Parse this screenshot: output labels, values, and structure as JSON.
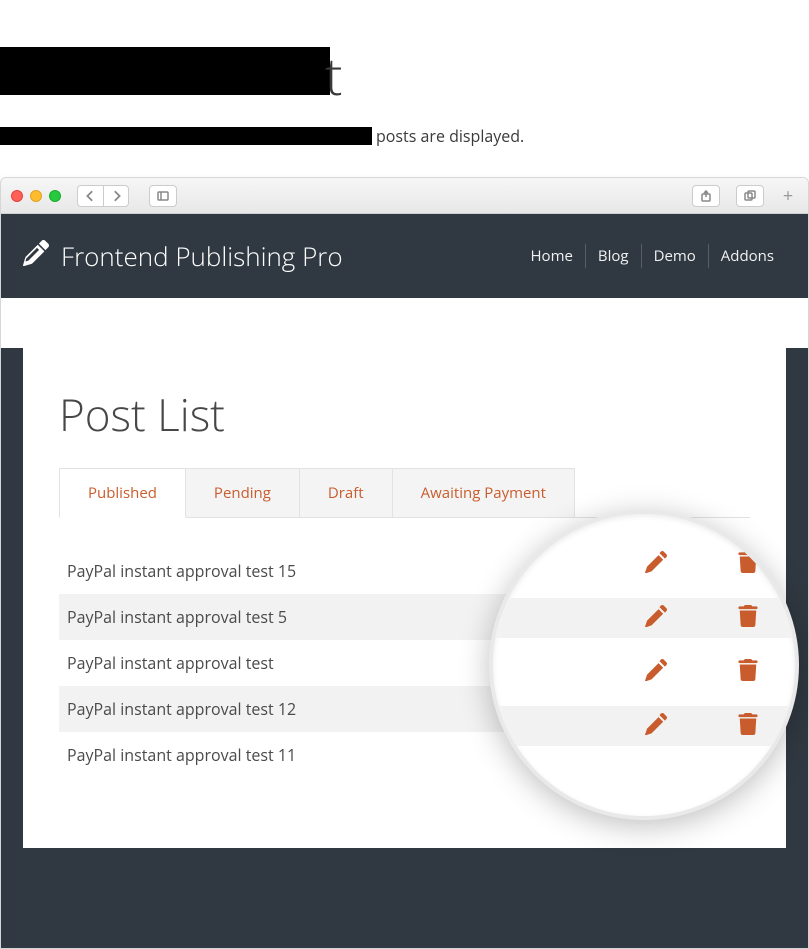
{
  "mask": {
    "title_tail": "t",
    "subtitle_tail": " posts are displayed."
  },
  "site": {
    "brand": "Frontend Publishing Pro",
    "nav": {
      "home": "Home",
      "blog": "Blog",
      "demo": "Demo",
      "addons": "Addons"
    }
  },
  "page": {
    "title": "Post List",
    "tabs": {
      "published": "Published",
      "pending": "Pending",
      "draft": "Draft",
      "awaiting": "Awaiting Payment"
    },
    "active_tab": "Published"
  },
  "posts": [
    {
      "title": "PayPal instant approval test 15",
      "has_link": false
    },
    {
      "title": "PayPal instant approval test 5",
      "has_link": true
    },
    {
      "title": "PayPal instant approval test",
      "has_link": false
    },
    {
      "title": "PayPal instant approval test 12",
      "has_link": true
    },
    {
      "title": "PayPal instant approval test 11",
      "has_link": true
    }
  ],
  "icons": {
    "pen_nib": "pen-nib-icon",
    "edit": "pencil-icon",
    "delete": "trash-icon",
    "link": "link-icon"
  },
  "colors": {
    "accent": "#c95c2d",
    "header": "#303841"
  }
}
